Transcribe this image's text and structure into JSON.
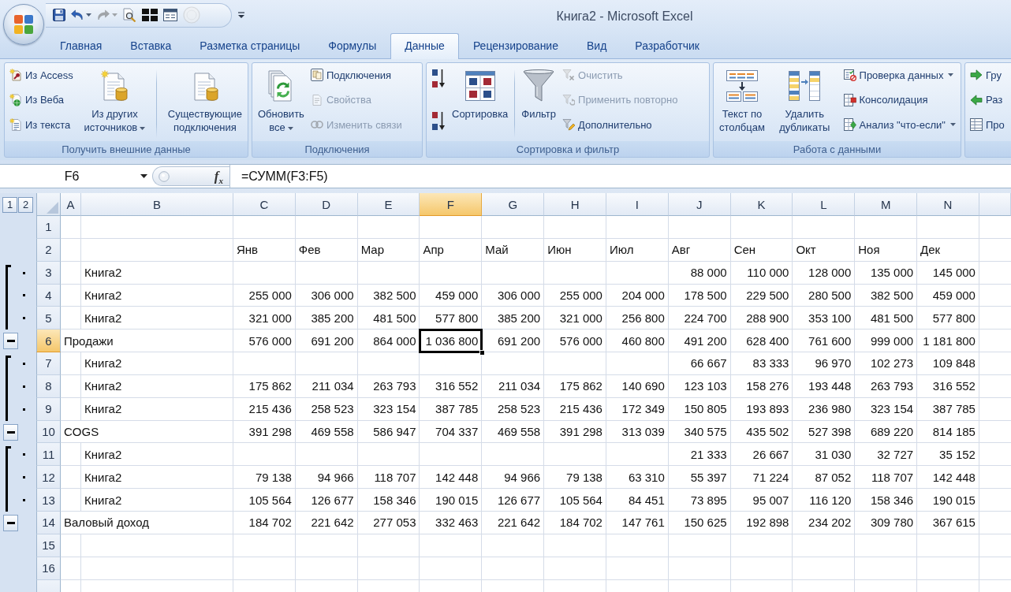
{
  "window": {
    "title": "Книга2 - Microsoft Excel"
  },
  "quick_access": [
    {
      "disabled": false,
      "dropdown": false
    },
    {
      "disabled": false,
      "dropdown": true
    },
    {
      "disabled": true,
      "dropdown": true
    },
    {
      "disabled": false,
      "dropdown": false
    },
    {
      "disabled": false,
      "dropdown": false
    },
    {
      "disabled": false,
      "dropdown": false
    },
    {
      "disabled": true,
      "dropdown": false
    }
  ],
  "tabs": [
    {
      "label": "Главная",
      "selected": false
    },
    {
      "label": "Вставка",
      "selected": false
    },
    {
      "label": "Разметка страницы",
      "selected": false
    },
    {
      "label": "Формулы",
      "selected": false
    },
    {
      "label": "Данные",
      "selected": true
    },
    {
      "label": "Рецензирование",
      "selected": false
    },
    {
      "label": "Вид",
      "selected": false
    },
    {
      "label": "Разработчик",
      "selected": false
    }
  ],
  "ribbon": {
    "groups": [
      {
        "title": "Получить внешние данные",
        "controls": [
          {
            "kind": "column",
            "items": [
              {
                "kind": "button",
                "label": "Из Access",
                "disabled": false,
                "dropdown": false
              },
              {
                "kind": "button",
                "label": "Из Веба",
                "disabled": false,
                "dropdown": false
              },
              {
                "kind": "button",
                "label": "Из текста",
                "disabled": false,
                "dropdown": false
              }
            ]
          },
          {
            "kind": "large",
            "label": "Из других\nисточников",
            "disabled": false,
            "dropdown": true
          },
          {
            "kind": "separator"
          },
          {
            "kind": "large",
            "label": "Существующие\nподключения",
            "disabled": false,
            "dropdown": false
          }
        ]
      },
      {
        "title": "Подключения",
        "controls": [
          {
            "kind": "large",
            "label": "Обновить\nвсе",
            "disabled": false,
            "dropdown": true
          },
          {
            "kind": "column",
            "items": [
              {
                "kind": "button",
                "label": "Подключения",
                "disabled": false,
                "dropdown": false
              },
              {
                "kind": "button",
                "label": "Свойства",
                "disabled": true,
                "dropdown": false
              },
              {
                "kind": "button",
                "label": "Изменить связи",
                "disabled": true,
                "dropdown": false
              }
            ]
          }
        ]
      },
      {
        "title": "Сортировка и фильтр",
        "controls": [
          {
            "kind": "column",
            "items": [
              {
                "kind": "icon",
                "disabled": false
              },
              {
                "kind": "icon",
                "disabled": false
              }
            ]
          },
          {
            "kind": "large",
            "label": "Сортировка",
            "disabled": false,
            "dropdown": false
          },
          {
            "kind": "separator"
          },
          {
            "kind": "large",
            "label": "Фильтр",
            "disabled": false,
            "dropdown": false
          },
          {
            "kind": "column",
            "items": [
              {
                "kind": "button",
                "label": "Очистить",
                "disabled": true,
                "dropdown": false
              },
              {
                "kind": "button",
                "label": "Применить повторно",
                "disabled": true,
                "dropdown": false
              },
              {
                "kind": "button",
                "label": "Дополнительно",
                "disabled": false,
                "dropdown": false
              }
            ]
          }
        ]
      },
      {
        "title": "Работа с данными",
        "controls": [
          {
            "kind": "large",
            "label": "Текст по\nстолбцам",
            "disabled": false,
            "dropdown": false
          },
          {
            "kind": "large",
            "label": "Удалить\nдубликаты",
            "disabled": false,
            "dropdown": false
          },
          {
            "kind": "column",
            "items": [
              {
                "kind": "button",
                "label": "Проверка данных",
                "disabled": false,
                "dropdown": true
              },
              {
                "kind": "button",
                "label": "Консолидация",
                "disabled": false,
                "dropdown": false
              },
              {
                "kind": "button",
                "label": "Анализ \"что-если\"",
                "disabled": false,
                "dropdown": true
              }
            ]
          }
        ]
      },
      {
        "controls": [
          {
            "kind": "column",
            "items": [
              {
                "kind": "button",
                "label": "Гру",
                "disabled": false,
                "dropdown": false
              },
              {
                "kind": "button",
                "label": "Раз",
                "disabled": false,
                "dropdown": false
              },
              {
                "kind": "button",
                "label": "Про",
                "disabled": false,
                "dropdown": false
              }
            ]
          }
        ]
      }
    ]
  },
  "formula_bar": {
    "name_box": "F6",
    "function_button": "f$_{x}$",
    "formula": "=СУММ(F3:F5)"
  },
  "sheet": {
    "outline_levels": [
      "1",
      "2"
    ],
    "columns": [
      {
        "label": "A",
        "selected": false
      },
      {
        "label": "B",
        "selected": false
      },
      {
        "label": "C",
        "selected": false
      },
      {
        "label": "D",
        "selected": false
      },
      {
        "label": "E",
        "selected": false
      },
      {
        "label": "F",
        "selected": true
      },
      {
        "label": "G",
        "selected": false
      },
      {
        "label": "H",
        "selected": false
      },
      {
        "label": "I",
        "selected": false
      },
      {
        "label": "J",
        "selected": false
      },
      {
        "label": "K",
        "selected": false
      },
      {
        "label": "L",
        "selected": false
      },
      {
        "label": "M",
        "selected": false
      },
      {
        "label": "N",
        "selected": false
      }
    ],
    "rows": [
      {
        "number": "1",
        "selected": false,
        "kind": "blank"
      },
      {
        "number": "2",
        "selected": false,
        "kind": "header",
        "values": [
          "Янв",
          "Фев",
          "Мар",
          "Апр",
          "Май",
          "Июн",
          "Июл",
          "Авг",
          "Сен",
          "Окт",
          "Ноя",
          "Дек"
        ]
      },
      {
        "number": "6",
        "selected": true,
        "kind": "total",
        "label": "Продажи",
        "values": [
          "576 000",
          "691 200",
          "864 000",
          "1 036 800",
          "691 200",
          "576 000",
          "460 800",
          "491 200",
          "628 400",
          "761 600",
          "999 000",
          "1 181 800"
        ],
        "expanded": true,
        "children": [
          {
            "number": "3",
            "selected": false,
            "kind": "detail",
            "label": "Книга2",
            "values": [
              "88 000",
              "110 000",
              "128 000",
              "135 000",
              "145 000"
            ]
          },
          {
            "number": "4",
            "selected": false,
            "kind": "detail",
            "label": "Книга2",
            "values": [
              "255 000",
              "306 000",
              "382 500",
              "459 000",
              "306 000",
              "255 000",
              "204 000",
              "178 500",
              "229 500",
              "280 500",
              "382 500",
              "459 000"
            ]
          },
          {
            "number": "5",
            "selected": false,
            "kind": "detail",
            "label": "Книга2",
            "values": [
              "321 000",
              "385 200",
              "481 500",
              "577 800",
              "385 200",
              "321 000",
              "256 800",
              "224 700",
              "288 900",
              "353 100",
              "481 500",
              "577 800"
            ]
          }
        ]
      },
      {
        "number": "10",
        "selected": false,
        "kind": "total",
        "label": "COGS",
        "values": [
          "391 298",
          "469 558",
          "586 947",
          "704 337",
          "469 558",
          "391 298",
          "313 039",
          "340 575",
          "435 502",
          "527 398",
          "689 220",
          "814 185"
        ],
        "expanded": true,
        "children": [
          {
            "number": "7",
            "selected": false,
            "kind": "detail",
            "label": "Книга2",
            "values": [
              "66 667",
              "83 333",
              "96 970",
              "102 273",
              "109 848"
            ]
          },
          {
            "number": "8",
            "selected": false,
            "kind": "detail",
            "label": "Книга2",
            "values": [
              "175 862",
              "211 034",
              "263 793",
              "316 552",
              "211 034",
              "175 862",
              "140 690",
              "123 103",
              "158 276",
              "193 448",
              "263 793",
              "316 552"
            ]
          },
          {
            "number": "9",
            "selected": false,
            "kind": "detail",
            "label": "Книга2",
            "values": [
              "215 436",
              "258 523",
              "323 154",
              "387 785",
              "258 523",
              "215 436",
              "172 349",
              "150 805",
              "193 893",
              "236 980",
              "323 154",
              "387 785"
            ]
          }
        ]
      },
      {
        "number": "14",
        "selected": false,
        "kind": "total",
        "label": "Валовый доход",
        "values": [
          "184 702",
          "221 642",
          "277 053",
          "332 463",
          "221 642",
          "184 702",
          "147 761",
          "150 625",
          "192 898",
          "234 202",
          "309 780",
          "367 615"
        ],
        "expanded": true,
        "children": [
          {
            "number": "11",
            "selected": false,
            "kind": "detail",
            "label": "Книга2",
            "values": [
              "21 333",
              "26 667",
              "31 030",
              "32 727",
              "35 152"
            ]
          },
          {
            "number": "12",
            "selected": false,
            "kind": "detail",
            "label": "Книга2",
            "values": [
              "79 138",
              "94 966",
              "118 707",
              "142 448",
              "94 966",
              "79 138",
              "63 310",
              "55 397",
              "71 224",
              "87 052",
              "118 707",
              "142 448"
            ]
          },
          {
            "number": "13",
            "selected": false,
            "kind": "detail",
            "label": "Книга2",
            "values": [
              "105 564",
              "126 677",
              "158 346",
              "190 015",
              "126 677",
              "105 564",
              "84 451",
              "73 895",
              "95 007",
              "116 120",
              "158 346",
              "190 015"
            ]
          }
        ]
      },
      {
        "number": "15",
        "selected": false,
        "kind": "blank"
      },
      {
        "number": "16",
        "selected": false,
        "kind": "blank"
      }
    ]
  }
}
